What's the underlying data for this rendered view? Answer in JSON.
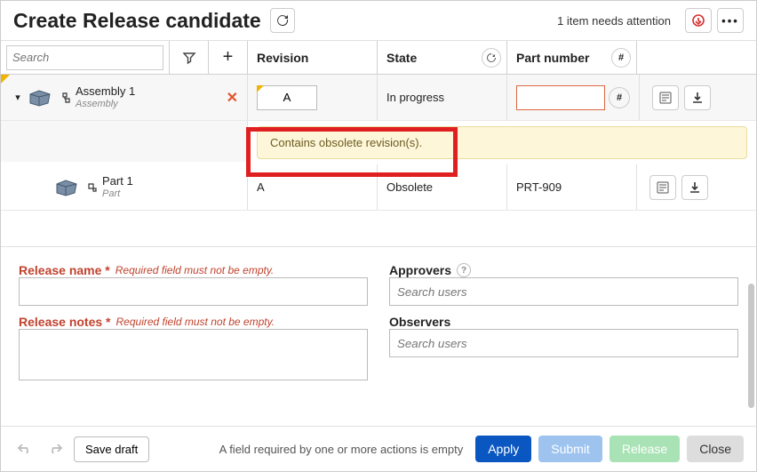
{
  "header": {
    "title": "Create Release candidate",
    "attention": "1 item needs attention"
  },
  "toolbar": {
    "search_placeholder": "Search",
    "col_revision": "Revision",
    "col_state": "State",
    "col_partnumber": "Part number"
  },
  "rows": {
    "assembly": {
      "name": "Assembly 1",
      "type": "Assembly",
      "rev": "A",
      "state": "In progress",
      "pn": ""
    },
    "warning": "Contains obsolete revision(s).",
    "part": {
      "name": "Part 1",
      "type": "Part",
      "rev": "A",
      "state": "Obsolete",
      "pn": "PRT-909"
    }
  },
  "form": {
    "release_name_label": "Release name *",
    "release_name_req": "Required field must not be empty.",
    "release_notes_label": "Release notes *",
    "release_notes_req": "Required field must not be empty.",
    "approvers_label": "Approvers",
    "observers_label": "Observers",
    "search_users_ph": "Search users"
  },
  "footer": {
    "save_draft": "Save draft",
    "message": "A field required by one or more actions is empty",
    "apply": "Apply",
    "submit": "Submit",
    "release": "Release",
    "close": "Close"
  }
}
